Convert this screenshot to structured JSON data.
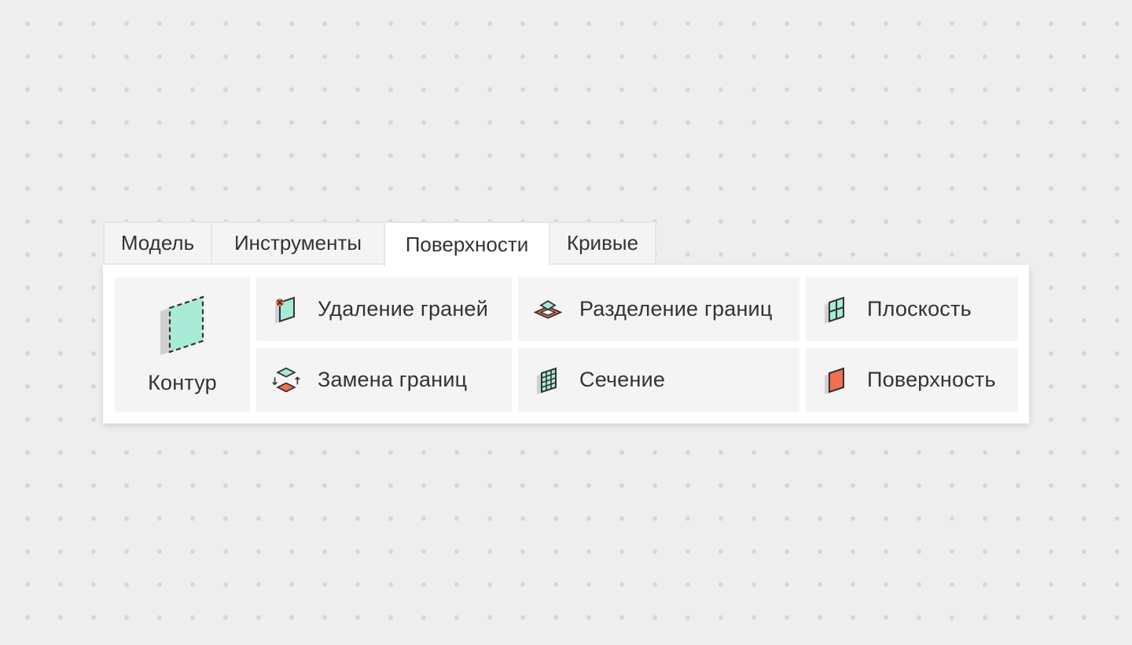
{
  "tabs": [
    {
      "label": "Модель",
      "active": false
    },
    {
      "label": "Инструменты",
      "active": false
    },
    {
      "label": "Поверхности",
      "active": true
    },
    {
      "label": "Кривые",
      "active": false
    }
  ],
  "tools": {
    "contour": {
      "label": "Контур",
      "icon": "contour-icon"
    },
    "delete_faces": {
      "label": "Удаление граней",
      "icon": "delete-faces-icon"
    },
    "split_borders": {
      "label": "Разделение границ",
      "icon": "split-borders-icon"
    },
    "plane": {
      "label": "Плоскость",
      "icon": "plane-icon"
    },
    "replace_borders": {
      "label": "Замена границ",
      "icon": "replace-borders-icon"
    },
    "section": {
      "label": "Сечение",
      "icon": "section-icon"
    },
    "surface": {
      "label": "Поверхность",
      "icon": "surface-icon"
    }
  },
  "colors": {
    "mint": "#a8ecd8",
    "coral": "#f07050",
    "outline": "#333333",
    "shadow": "#d0d0d0",
    "button_bg": "#f4f4f4",
    "panel_bg": "#ffffff"
  }
}
